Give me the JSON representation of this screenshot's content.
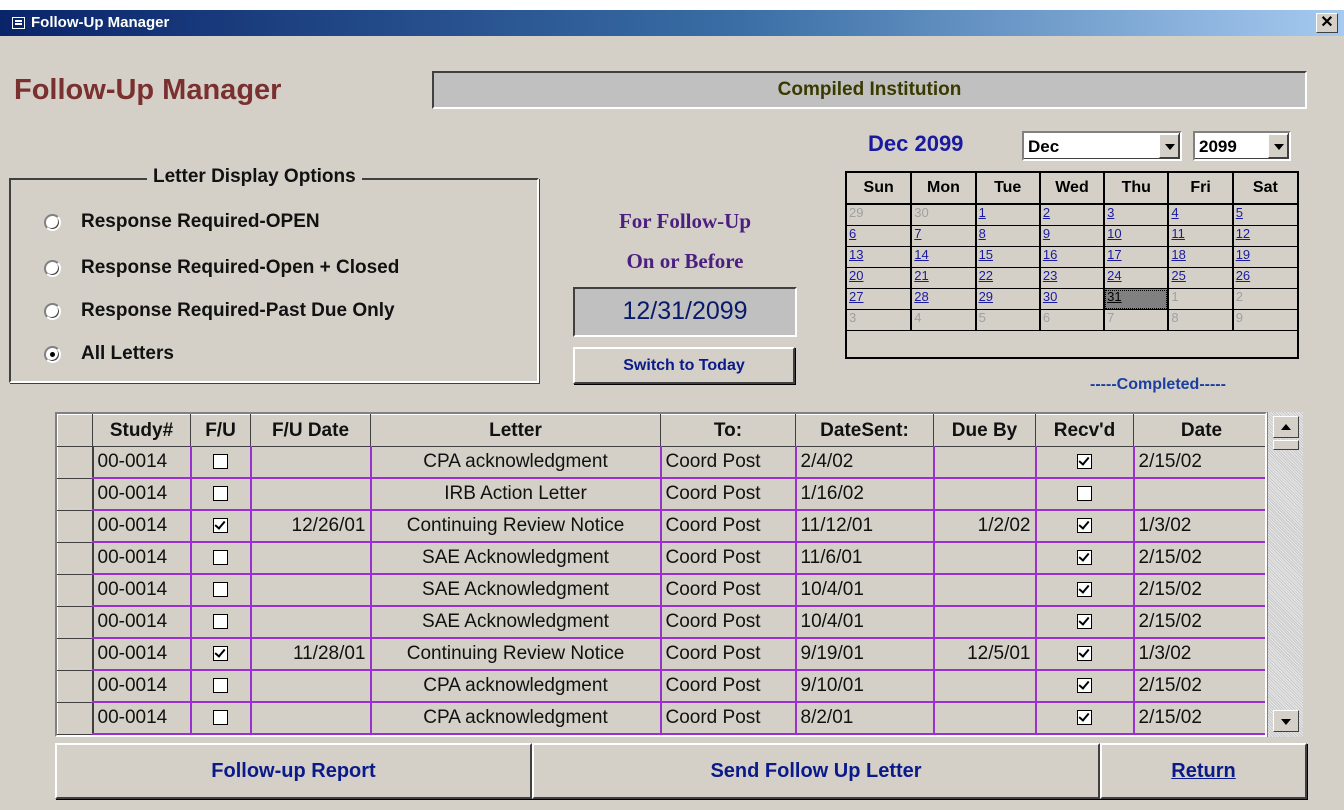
{
  "window": {
    "title": "Follow-Up Manager",
    "close_glyph": "✕"
  },
  "header": {
    "heading": "Follow-Up Manager",
    "institution": "Compiled Institution"
  },
  "options": {
    "legend": "Letter Display Options",
    "items": [
      {
        "label": "Response Required-OPEN",
        "selected": false
      },
      {
        "label": "Response Required-Open + Closed",
        "selected": false
      },
      {
        "label": "Response Required-Past Due Only",
        "selected": false
      },
      {
        "label": "All Letters",
        "selected": true
      }
    ]
  },
  "followup": {
    "line1": "For Follow-Up",
    "line2": "On or Before",
    "date": "12/31/2099",
    "switch_label": "Switch to Today"
  },
  "calendar": {
    "title": "Dec 2099",
    "month": "Dec",
    "year": "2099",
    "days": [
      "Sun",
      "Mon",
      "Tue",
      "Wed",
      "Thu",
      "Fri",
      "Sat"
    ],
    "weeks": [
      [
        "29",
        "30",
        "1",
        "2",
        "3",
        "4",
        "5"
      ],
      [
        "6",
        "7",
        "8",
        "9",
        "10",
        "11",
        "12"
      ],
      [
        "13",
        "14",
        "15",
        "16",
        "17",
        "18",
        "19"
      ],
      [
        "20",
        "21",
        "22",
        "23",
        "24",
        "25",
        "26"
      ],
      [
        "27",
        "28",
        "29",
        "30",
        "31",
        "1",
        "2"
      ],
      [
        "3",
        "4",
        "5",
        "6",
        "7",
        "8",
        "9"
      ]
    ],
    "selected_day": "31"
  },
  "completed_label": "-----Completed-----",
  "grid": {
    "columns": [
      "Study#",
      "F/U",
      "F/U Date",
      "Letter",
      "To:",
      "DateSent:",
      "Due By",
      "Recv'd",
      "Date"
    ],
    "rows": [
      {
        "study": "00-0014",
        "fu": false,
        "fu_date": "",
        "letter": "CPA acknowledgment",
        "to": "Coord Post",
        "sent": "2/4/02",
        "due": "",
        "recvd": true,
        "date": "2/15/02"
      },
      {
        "study": "00-0014",
        "fu": false,
        "fu_date": "",
        "letter": "IRB Action Letter",
        "to": "Coord Post",
        "sent": "1/16/02",
        "due": "",
        "recvd": false,
        "date": ""
      },
      {
        "study": "00-0014",
        "fu": true,
        "fu_date": "12/26/01",
        "letter": "Continuing Review Notice",
        "to": "Coord Post",
        "sent": "11/12/01",
        "due": "1/2/02",
        "recvd": true,
        "date": "1/3/02"
      },
      {
        "study": "00-0014",
        "fu": false,
        "fu_date": "",
        "letter": "SAE Acknowledgment",
        "to": "Coord Post",
        "sent": "11/6/01",
        "due": "",
        "recvd": true,
        "date": "2/15/02"
      },
      {
        "study": "00-0014",
        "fu": false,
        "fu_date": "",
        "letter": "SAE Acknowledgment",
        "to": "Coord Post",
        "sent": "10/4/01",
        "due": "",
        "recvd": true,
        "date": "2/15/02"
      },
      {
        "study": "00-0014",
        "fu": false,
        "fu_date": "",
        "letter": "SAE Acknowledgment",
        "to": "Coord Post",
        "sent": "10/4/01",
        "due": "",
        "recvd": true,
        "date": "2/15/02"
      },
      {
        "study": "00-0014",
        "fu": true,
        "fu_date": "11/28/01",
        "letter": "Continuing Review Notice",
        "to": "Coord Post",
        "sent": "9/19/01",
        "due": "12/5/01",
        "recvd": true,
        "date": "1/3/02"
      },
      {
        "study": "00-0014",
        "fu": false,
        "fu_date": "",
        "letter": "CPA acknowledgment",
        "to": "Coord Post",
        "sent": "9/10/01",
        "due": "",
        "recvd": true,
        "date": "2/15/02"
      },
      {
        "study": "00-0014",
        "fu": false,
        "fu_date": "",
        "letter": "CPA acknowledgment",
        "to": "Coord Post",
        "sent": "8/2/01",
        "due": "",
        "recvd": true,
        "date": "2/15/02"
      }
    ]
  },
  "buttons": {
    "report": "Follow-up Report",
    "send": "Send Follow Up Letter",
    "return": "Return"
  },
  "colors": {
    "title_bar": "#0a246a",
    "heading": "#7b3030",
    "grid_lines": "#9b30d0",
    "button_text": "#0a1a8a"
  }
}
